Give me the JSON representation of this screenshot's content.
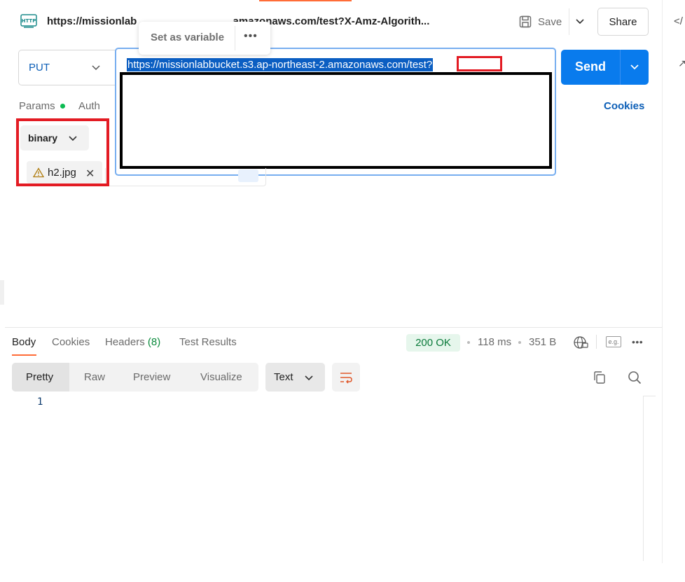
{
  "request": {
    "title": "https://missionlab… .amazonaws.com/test?X-Amz-Algorith…",
    "title_left": "https://missionlab",
    "title_right": ".amazonaws.com/test?X-Amz-Algorith...",
    "save_label": "Save",
    "share_label": "Share",
    "method": "PUT",
    "url_selected": "https://missionlabbucket.s3.ap-northeast-2.amazonaws.com/test?",
    "send_label": "Send"
  },
  "popover": {
    "set_variable_label": "Set as variable",
    "more_label": "•••"
  },
  "request_tabs": {
    "params": "Params",
    "auth": "Auth",
    "cookies": "Cookies"
  },
  "body": {
    "mode": "binary",
    "file_name": "h2.jpg"
  },
  "response": {
    "tabs": {
      "body": "Body",
      "cookies": "Cookies",
      "headers": "Headers",
      "headers_count": "(8)",
      "test_results": "Test Results"
    },
    "status": "200 OK",
    "time": "118 ms",
    "size": "351 B",
    "eg_label": "e.g.",
    "more_label": "•••",
    "view_tabs": [
      "Pretty",
      "Raw",
      "Preview",
      "Visualize"
    ],
    "format": "Text",
    "line_number": "1"
  },
  "colors": {
    "accent": "#ff6c37",
    "send": "#097bed",
    "annotation_red": "#e31b23",
    "status_green": "#0a7a3a"
  }
}
